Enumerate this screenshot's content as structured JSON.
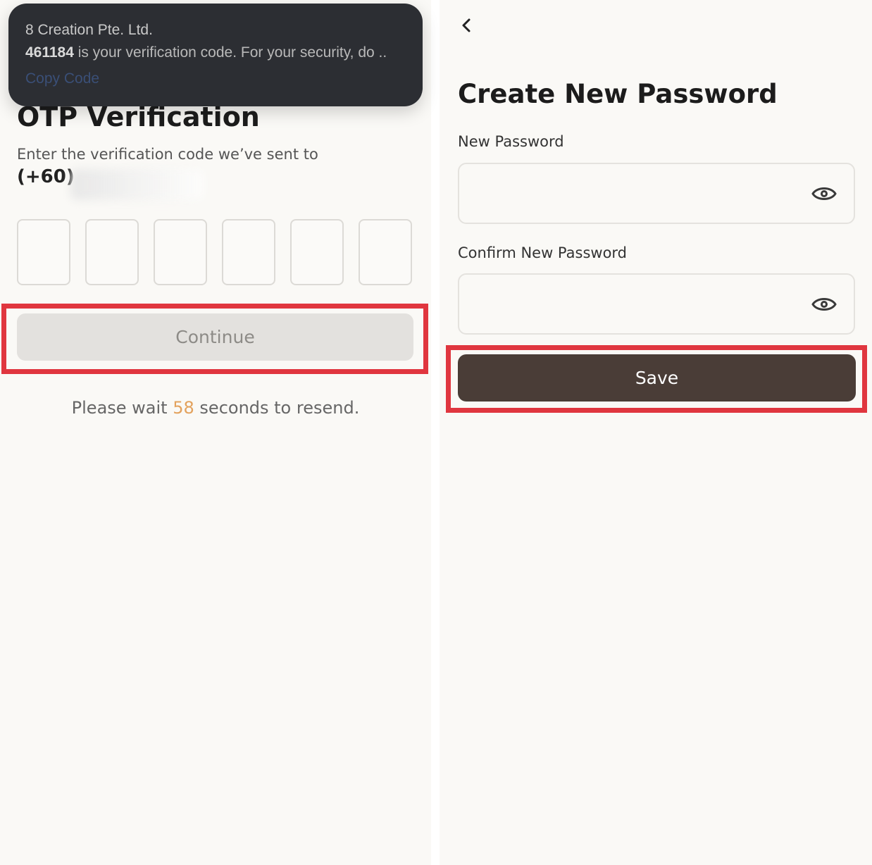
{
  "notification": {
    "sender": "8 Creation Pte. Ltd.",
    "code": "461184",
    "message_rest": "is your verification code. For your security, do ..",
    "copy_label": "Copy Code"
  },
  "otp_screen": {
    "title": "OTP Verification",
    "subtitle": "Enter the verification code we’ve sent to",
    "country_code": "(+60)",
    "code_boxes": [
      "",
      "",
      "",
      "",
      "",
      ""
    ],
    "continue_label": "Continue",
    "resend_prefix": "Please wait",
    "resend_seconds": "58",
    "resend_suffix": "seconds to resend."
  },
  "password_screen": {
    "title": "Create New Password",
    "new_password_label": "New Password",
    "confirm_password_label": "Confirm New Password",
    "save_label": "Save"
  },
  "colors": {
    "highlight": "#e0363f",
    "save_button": "#4a3d37",
    "countdown": "#e3a25d",
    "disabled_button": "#e3e1de"
  },
  "icons": [
    "back-chevron-icon",
    "eye-icon"
  ]
}
